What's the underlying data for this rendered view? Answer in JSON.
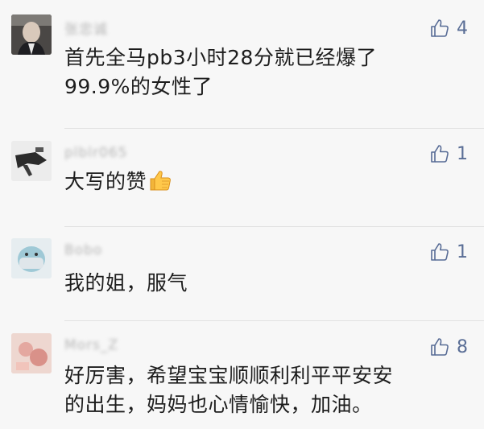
{
  "comments": [
    {
      "name": "张忠诚",
      "likes": "4",
      "lines": [
        "首先全马pb3小时28分就已经爆了",
        "99.9%的女性了"
      ],
      "avatar": "portrait-avatar"
    },
    {
      "name": "plblr065",
      "likes": "1",
      "lines": [
        "大写的赞"
      ],
      "emoji": "thumbs-up-emoji",
      "avatar": "bird-avatar"
    },
    {
      "name": "Bobo",
      "likes": "1",
      "lines": [
        "我的姐，服气"
      ],
      "avatar": "masked-face-avatar"
    },
    {
      "name": "Mors_Z",
      "likes": "8",
      "lines": [
        "好厉害，希望宝宝顺顺利利平平安安",
        "的出生，妈妈也心情愉快，加油。"
      ],
      "avatar": "pink-avatar"
    }
  ],
  "colors": {
    "background": "#f7f7f7",
    "like": "#576b95",
    "text": "#1d1d1d"
  }
}
